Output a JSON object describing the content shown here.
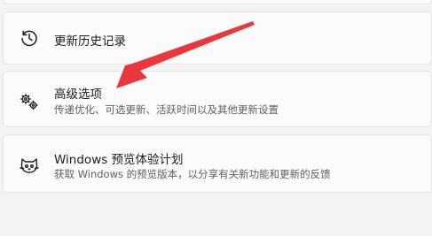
{
  "settings": {
    "items": [
      {
        "title": "更新历史记录",
        "icon": "history-icon"
      },
      {
        "title": "高级选项",
        "subtitle": "传递优化、可选更新、活跃时间以及其他更新设置",
        "icon": "gears-icon"
      },
      {
        "title": "Windows 预览体验计划",
        "subtitle": "获取 Windows 的预览版本，以分享有关新功能和更新的反馈",
        "icon": "insider-cat-icon"
      }
    ]
  },
  "annotation": {
    "color": "#e8383d"
  }
}
